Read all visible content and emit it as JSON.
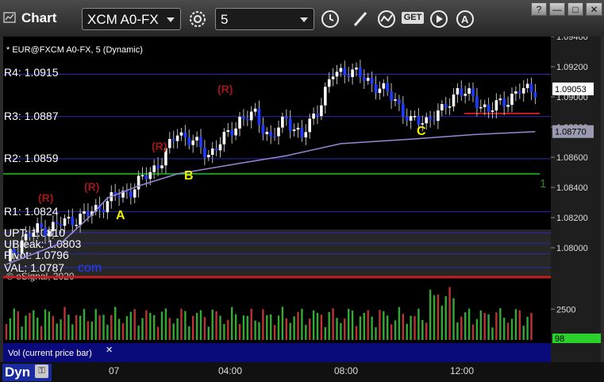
{
  "toolbar": {
    "title": "Chart",
    "symbol": "XCM A0-FX",
    "interval": "5",
    "icons": [
      "chart-icon",
      "settings-gear-icon",
      "clock-icon",
      "pencil-icon",
      "study-icon",
      "get-icon",
      "play-icon",
      "alert-icon"
    ],
    "window_buttons": [
      "?",
      "—",
      "□",
      "✕"
    ]
  },
  "price_pane": {
    "header": "* EUR@FXCM A0-FX, 5 (Dynamic)",
    "copyright": "© eSignal, 2020",
    "watermark": "com",
    "levels": [
      {
        "label": "R4: 1.0915",
        "value": 1.0915
      },
      {
        "label": "R3: 1.0887",
        "value": 1.0887
      },
      {
        "label": "R2: 1.0859",
        "value": 1.0859
      },
      {
        "label": "R1: 1.0824",
        "value": 1.0824
      },
      {
        "label": "UPT: 1.0810",
        "value": 1.081
      },
      {
        "label": "UBreak: 1.0803",
        "value": 1.0803
      },
      {
        "label": "Pivot: 1.0796",
        "value": 1.0796
      },
      {
        "label": "VAL: 1.0787",
        "value": 1.0787
      }
    ],
    "current_price": "1.09053",
    "ma_price": "1.08770",
    "markers": [
      "A",
      "B",
      "C"
    ],
    "r_markers": [
      "(R)",
      "(R)",
      "(R)",
      "(R)"
    ],
    "count_label": "1"
  },
  "volume_pane": {
    "title": "Vol (current price bar)",
    "close_icon": "✕",
    "current_value": "98",
    "axis_label": "2500"
  },
  "bottom": {
    "mode": "Dyn",
    "lock_icon": "⚿"
  },
  "colors": {
    "background": "#000000",
    "up_candle": "#ffffff",
    "down_candle": "#1e3cff",
    "level_line": "#2a2ab0",
    "green_line": "#1a9a1a",
    "red_line": "#c81e1e",
    "ma_line": "#9a86d8",
    "setup_count": "#1f8a1f",
    "marker_text": "#f0f000",
    "r_text": "#a01818"
  },
  "chart_data": {
    "type": "candlestick",
    "symbol": "EUR@FXCM A0-FX",
    "interval": "5",
    "x_tick_labels": [
      "07",
      "04:00",
      "08:00",
      "12:00"
    ],
    "y_tick_labels": [
      "1.09400",
      "1.09200",
      "1.09000",
      "1.08800",
      "1.08600",
      "1.08400",
      "1.08200",
      "1.08000"
    ],
    "ylim": [
      1.0787,
      1.0945
    ],
    "pivot_levels": [
      {
        "name": "R4",
        "value": 1.0915
      },
      {
        "name": "R3",
        "value": 1.0887
      },
      {
        "name": "R2",
        "value": 1.0859
      },
      {
        "name": "R1",
        "value": 1.0824
      },
      {
        "name": "UPT",
        "value": 1.081
      },
      {
        "name": "UBreak",
        "value": 1.0803
      },
      {
        "name": "Pivot",
        "value": 1.0796
      },
      {
        "name": "VAL",
        "value": 1.0787
      }
    ],
    "extra_levels": [
      {
        "value": 1.0849,
        "color": "green"
      },
      {
        "value": 1.0889,
        "color": "red"
      }
    ],
    "last_price": 1.09053,
    "ma_value": 1.0877,
    "close_path": [
      [
        0,
        1.0791
      ],
      [
        4,
        1.0805
      ],
      [
        8,
        1.0812
      ],
      [
        12,
        1.0814
      ],
      [
        16,
        1.0818
      ],
      [
        20,
        1.0821
      ],
      [
        24,
        1.0827
      ],
      [
        28,
        1.0834
      ],
      [
        32,
        1.0838
      ],
      [
        36,
        1.0848
      ],
      [
        40,
        1.0858
      ],
      [
        44,
        1.0877
      ],
      [
        48,
        1.087
      ],
      [
        52,
        1.0862
      ],
      [
        56,
        1.0872
      ],
      [
        60,
        1.0885
      ],
      [
        64,
        1.0888
      ],
      [
        68,
        1.0872
      ],
      [
        72,
        1.0886
      ],
      [
        76,
        1.0873
      ],
      [
        80,
        1.0892
      ],
      [
        84,
        1.0915
      ],
      [
        88,
        1.0918
      ],
      [
        92,
        1.0912
      ],
      [
        96,
        1.0906
      ],
      [
        100,
        1.0898
      ],
      [
        104,
        1.0883
      ],
      [
        108,
        1.0885
      ],
      [
        112,
        1.089
      ],
      [
        116,
        1.0905
      ],
      [
        120,
        1.0899
      ],
      [
        124,
        1.0891
      ],
      [
        128,
        1.0897
      ],
      [
        132,
        1.0904
      ],
      [
        136,
        1.0905
      ]
    ],
    "ma_path": [
      [
        0,
        1.0789
      ],
      [
        14,
        1.0803
      ],
      [
        22,
        1.0822
      ],
      [
        26,
        1.0833
      ],
      [
        34,
        1.0841
      ],
      [
        44,
        1.0849
      ],
      [
        60,
        1.0856
      ],
      [
        72,
        1.0861
      ],
      [
        86,
        1.0869
      ],
      [
        104,
        1.0872
      ],
      [
        120,
        1.0875
      ],
      [
        136,
        1.0877
      ]
    ],
    "volume_ylim": [
      0,
      4000
    ],
    "volume_tick": 2500,
    "current_volume": 98
  }
}
